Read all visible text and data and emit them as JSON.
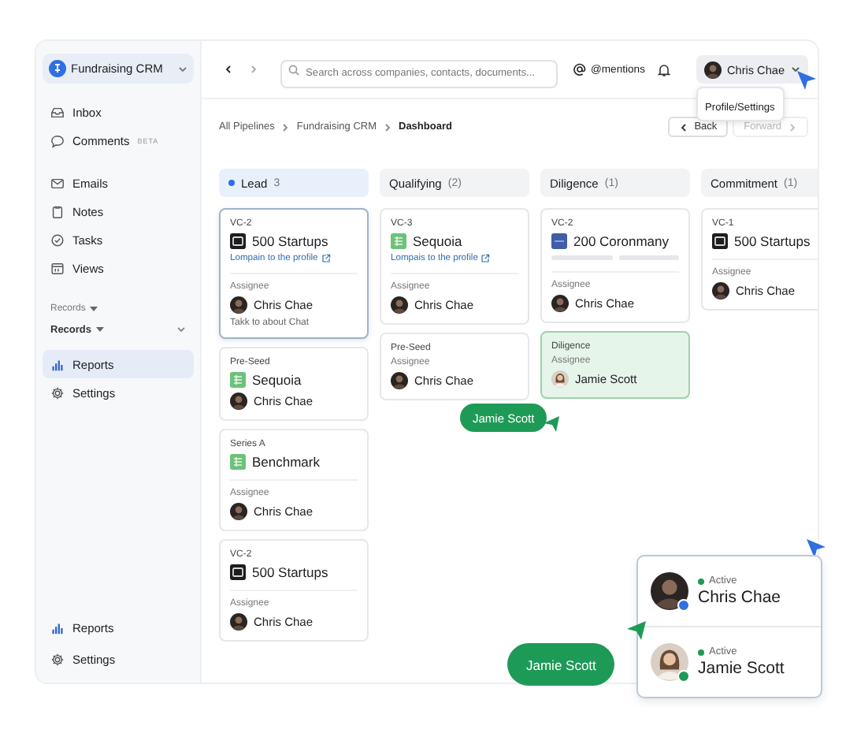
{
  "sidebar": {
    "workspace": "Fundraising CRM",
    "sections": [
      {
        "items": [
          {
            "kind": "nav",
            "label": "Inbox",
            "selected": false
          },
          {
            "kind": "nav",
            "label": "Comments",
            "badge": "BETA",
            "selected": false
          }
        ]
      },
      {
        "items": [
          {
            "kind": "nav",
            "label": "Emails",
            "selected": false
          },
          {
            "kind": "nav",
            "label": "Notes",
            "selected": false
          },
          {
            "kind": "nav",
            "label": "Tasks",
            "selected": false
          },
          {
            "kind": "nav",
            "label": "Views",
            "selected": false
          }
        ]
      },
      {
        "items": [
          {
            "kind": "label",
            "label": "Records"
          },
          {
            "kind": "heading",
            "label": "Records"
          },
          {
            "kind": "nav",
            "label": "Reports",
            "selected": true
          },
          {
            "kind": "nav",
            "label": "Settings",
            "selected": false
          }
        ]
      }
    ],
    "footer": [
      {
        "label": "Reports"
      },
      {
        "label": "Settings"
      }
    ]
  },
  "topbar": {
    "search": {
      "placeholder": "Search across companies, contacts, documents..."
    },
    "mentions": "@mentions",
    "user": "Chris Chae",
    "menu": [
      "Profile/Settings"
    ]
  },
  "breadcrumbs": [
    "All Pipelines",
    "Fundraising CRM",
    "Dashboard"
  ],
  "nav_buttons": [
    {
      "label": "Back",
      "disabled": false
    },
    {
      "label": "Forward",
      "disabled": true
    }
  ],
  "columns": [
    {
      "name": "Lead",
      "count": "3",
      "selected": true,
      "cards": [
        {
          "stage": "VC-2",
          "company": {
            "name": "500 Startups",
            "kind": "dark"
          },
          "link": "Lompain to the profile",
          "assignee_label": "Assignee",
          "assignee": {
            "name": "Chris Chae",
            "kind": "dark"
          },
          "note": "Takk to about Chat",
          "selected": true,
          "drop_target": false
        },
        {
          "stage": "Pre-Seed",
          "company": {
            "name": "Sequoia",
            "kind": "sheet"
          },
          "assignee": {
            "name": "Chris Chae",
            "kind": "dark"
          },
          "selected": false,
          "drop_target": false
        },
        {
          "stage": "Series A",
          "company": {
            "name": "Benchmark",
            "kind": "sheet"
          },
          "assignee_label": "Assignee",
          "assignee": {
            "name": "Chris Chae",
            "kind": "dark"
          },
          "selected": false,
          "drop_target": false
        },
        {
          "stage": "VC-2",
          "company": {
            "name": "500 Startups",
            "kind": "dark"
          },
          "assignee_label": "Assignee",
          "assignee": {
            "name": "Chris Chae",
            "kind": "dark"
          },
          "selected": false,
          "drop_target": false
        }
      ]
    },
    {
      "name": "Qualifying",
      "count": "(2)",
      "selected": false,
      "cards": [
        {
          "stage": "VC-3",
          "company": {
            "name": "Sequoia",
            "kind": "sheet"
          },
          "link": "Lompais to the profile",
          "assignee_label": "Assignee",
          "assignee": {
            "name": "Chris Chae",
            "kind": "dark"
          },
          "selected": false,
          "drop_target": false
        },
        {
          "stage": "Pre-Seed",
          "assignee_label": "Assignee",
          "assignee": {
            "name": "Chris Chae",
            "kind": "dark"
          },
          "selected": false,
          "drop_target": false
        }
      ]
    },
    {
      "name": "Diligence",
      "count": "(1)",
      "selected": false,
      "cards": [
        {
          "stage": "VC-2",
          "company": {
            "name": "200 Coronmany",
            "kind": "blue"
          },
          "loading": true,
          "assignee_label": "Assignee",
          "assignee": {
            "name": "Chris Chae",
            "kind": "dark"
          },
          "selected": false,
          "drop_target": false
        },
        {
          "stage": "Diligence",
          "assignee_label": "Assignee",
          "assignee": {
            "name": "Jamie Scott",
            "kind": "light"
          },
          "selected": false,
          "drop_target": true
        }
      ]
    },
    {
      "name": "Commitment",
      "count": "(1)",
      "selected": false,
      "cards": [
        {
          "stage": "VC-1",
          "company": {
            "name": "500 Startups",
            "kind": "dark"
          },
          "assignee_label": "Assignee",
          "assignee": {
            "name": "Chris Chae",
            "kind": "dark"
          },
          "selected": false,
          "drop_target": false
        }
      ]
    }
  ],
  "drag_cursor": {
    "name": "Jamie Scott"
  },
  "presence": {
    "users": [
      {
        "status": "Active",
        "name": "Chris Chae",
        "kind": "dark",
        "color": "#2f6fe0"
      },
      {
        "status": "Active",
        "name": "Jamie Scott",
        "kind": "light",
        "color": "#1e9a57"
      }
    ],
    "cursor_label": "Jamie Scott"
  }
}
